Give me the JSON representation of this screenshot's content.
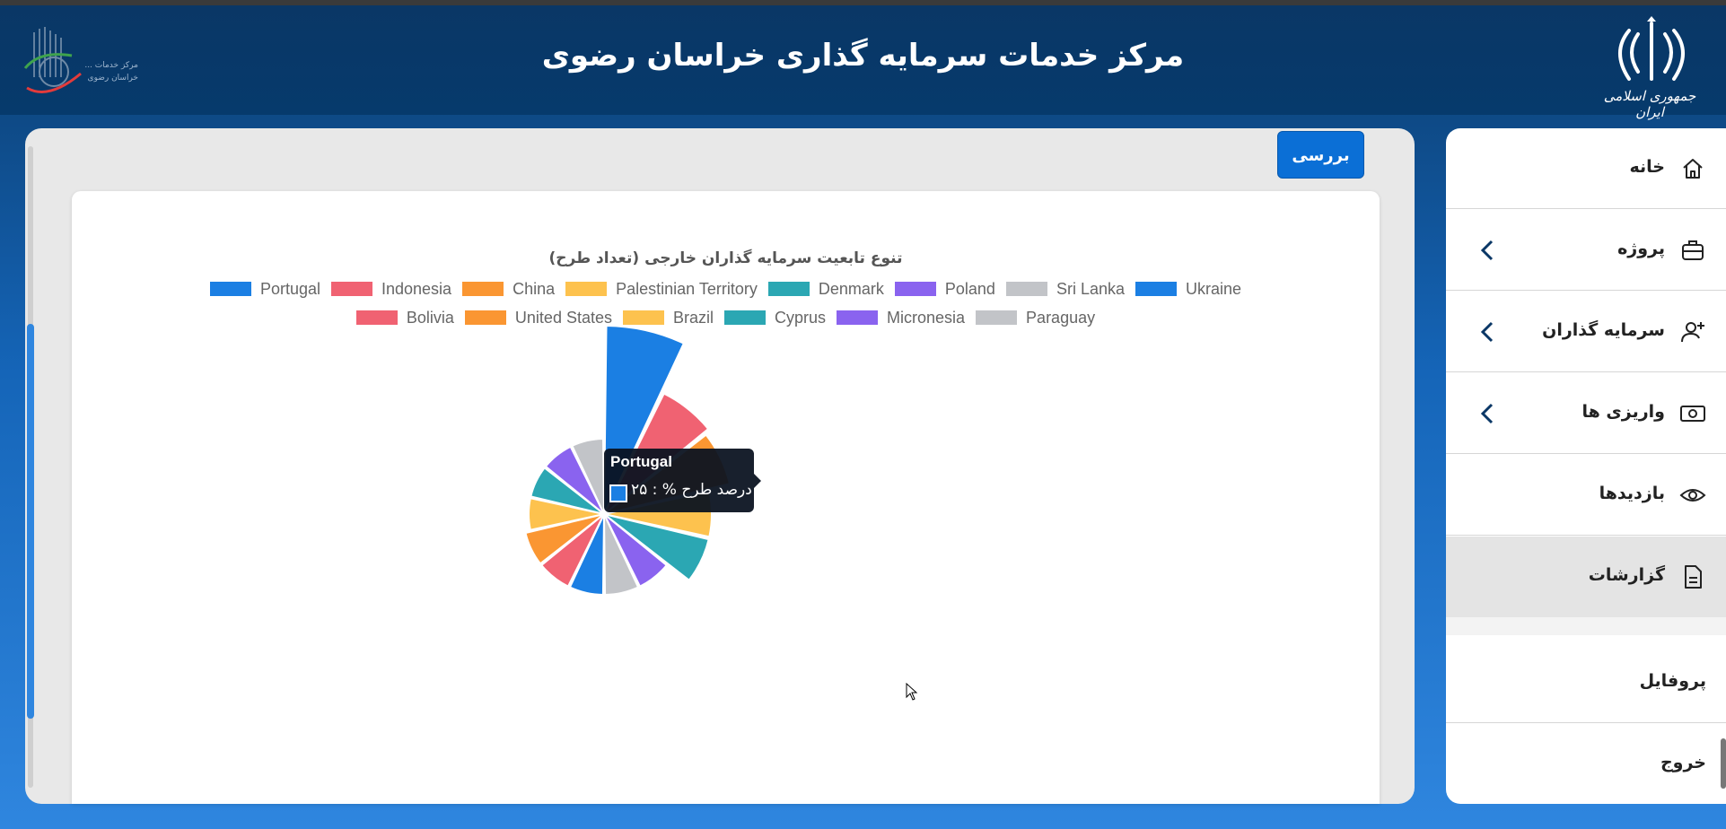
{
  "header": {
    "title": "مرکز خدمات سرمایه گذاری خراسان رضوی",
    "emblem_caption": "جمهوری اسلامی ایران",
    "org_logo_text": "مرکز خدمات ... خراسان رضوی"
  },
  "sidebar": {
    "items": [
      {
        "label": "خانه",
        "icon": "home-icon",
        "chevron": false
      },
      {
        "label": "پروژه",
        "icon": "briefcase-icon",
        "chevron": true
      },
      {
        "label": "سرمایه گذاران",
        "icon": "add-user-icon",
        "chevron": true
      },
      {
        "label": "واریزی ها",
        "icon": "money-icon",
        "chevron": true
      },
      {
        "label": "بازدیدها",
        "icon": "eye-icon",
        "chevron": false
      },
      {
        "label": "گزارشات",
        "icon": "document-icon",
        "chevron": false,
        "active": true
      },
      {
        "label": "پروفایل",
        "icon": "",
        "chevron": false
      },
      {
        "label": "خروج",
        "icon": "",
        "chevron": false
      }
    ]
  },
  "toolbar": {
    "check_label": "بررسی"
  },
  "tooltip": {
    "title": "Portugal",
    "text": "درصد طرح % : ۲۵"
  },
  "chart_data": {
    "type": "pie",
    "title": "تنوع تابعیت سرمایه گذاران خارجی (تعداد طرح)",
    "legend_position": "top",
    "categories": [
      "Portugal",
      "Indonesia",
      "China",
      "Palestinian Territory",
      "Denmark",
      "Poland",
      "Sri Lanka",
      "Ukraine",
      "Bolivia",
      "United States",
      "Brazil",
      "Cyprus",
      "Micronesia",
      "Paraguay"
    ],
    "values": [
      25,
      15,
      14,
      10,
      10,
      5,
      5,
      5,
      5,
      5,
      4,
      4,
      4,
      4
    ],
    "colors": [
      "#1b7fe3",
      "#f06272",
      "#fa9632",
      "#fdc24e",
      "#2ba7b3",
      "#8a63ef",
      "#c2c4c8",
      "#1b7fe3",
      "#f06272",
      "#fa9632",
      "#fdc24e",
      "#2ba7b3",
      "#8a63ef",
      "#c2c4c8"
    ],
    "legend_rows": [
      [
        0,
        1,
        2,
        3,
        4,
        5,
        6,
        7
      ],
      [
        8,
        9,
        10,
        11,
        12,
        13
      ]
    ]
  }
}
